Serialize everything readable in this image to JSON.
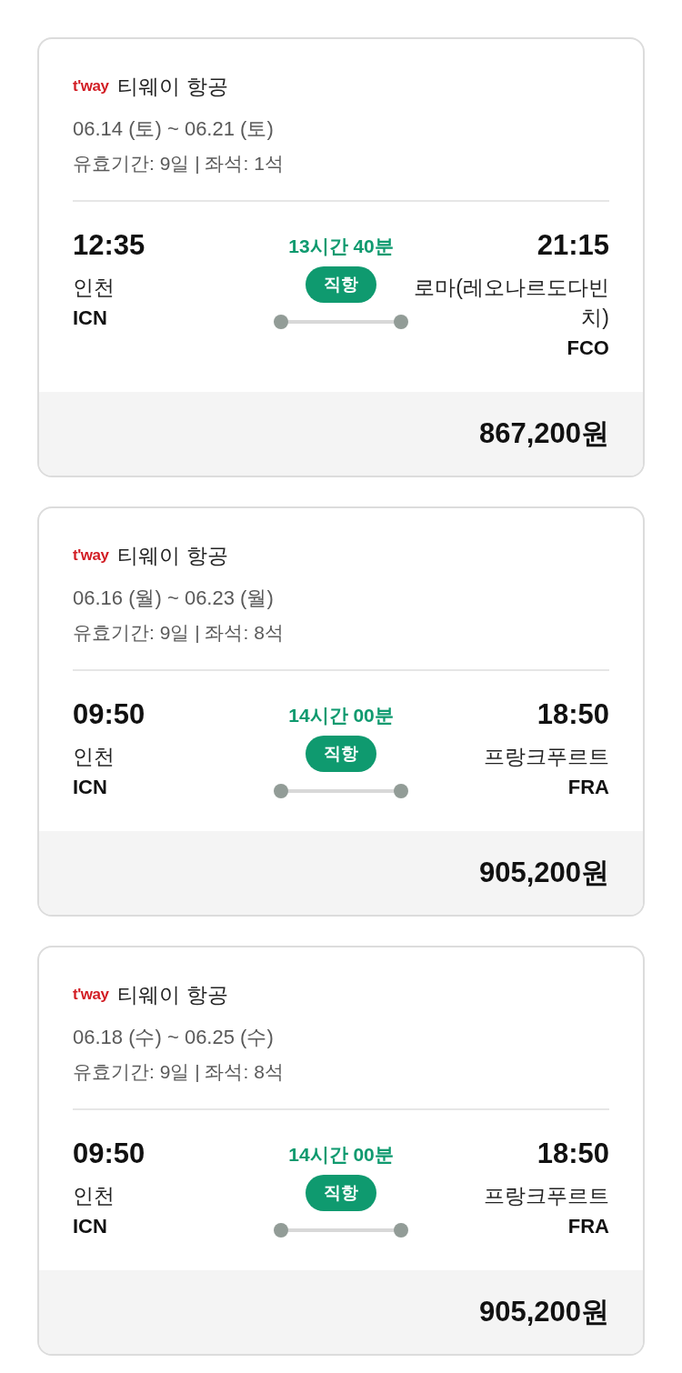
{
  "flights": [
    {
      "logo": "t'way",
      "airline": "티웨이 항공",
      "dates": "06.14 (토) ~ 06.21 (토)",
      "info": "유효기간: 9일 | 좌석: 1석",
      "departure": {
        "time": "12:35",
        "city": "인천",
        "code": "ICN"
      },
      "duration": "13시간 40분",
      "badge": "직항",
      "arrival": {
        "time": "21:15",
        "city": "로마(레오나르도다빈치)",
        "code": "FCO"
      },
      "price": "867,200원"
    },
    {
      "logo": "t'way",
      "airline": "티웨이 항공",
      "dates": "06.16 (월) ~ 06.23 (월)",
      "info": "유효기간: 9일 | 좌석: 8석",
      "departure": {
        "time": "09:50",
        "city": "인천",
        "code": "ICN"
      },
      "duration": "14시간 00분",
      "badge": "직항",
      "arrival": {
        "time": "18:50",
        "city": "프랑크푸르트",
        "code": "FRA"
      },
      "price": "905,200원"
    },
    {
      "logo": "t'way",
      "airline": "티웨이 항공",
      "dates": "06.18 (수) ~ 06.25 (수)",
      "info": "유효기간: 9일 | 좌석: 8석",
      "departure": {
        "time": "09:50",
        "city": "인천",
        "code": "ICN"
      },
      "duration": "14시간 00분",
      "badge": "직항",
      "arrival": {
        "time": "18:50",
        "city": "프랑크푸르트",
        "code": "FRA"
      },
      "price": "905,200원"
    }
  ]
}
